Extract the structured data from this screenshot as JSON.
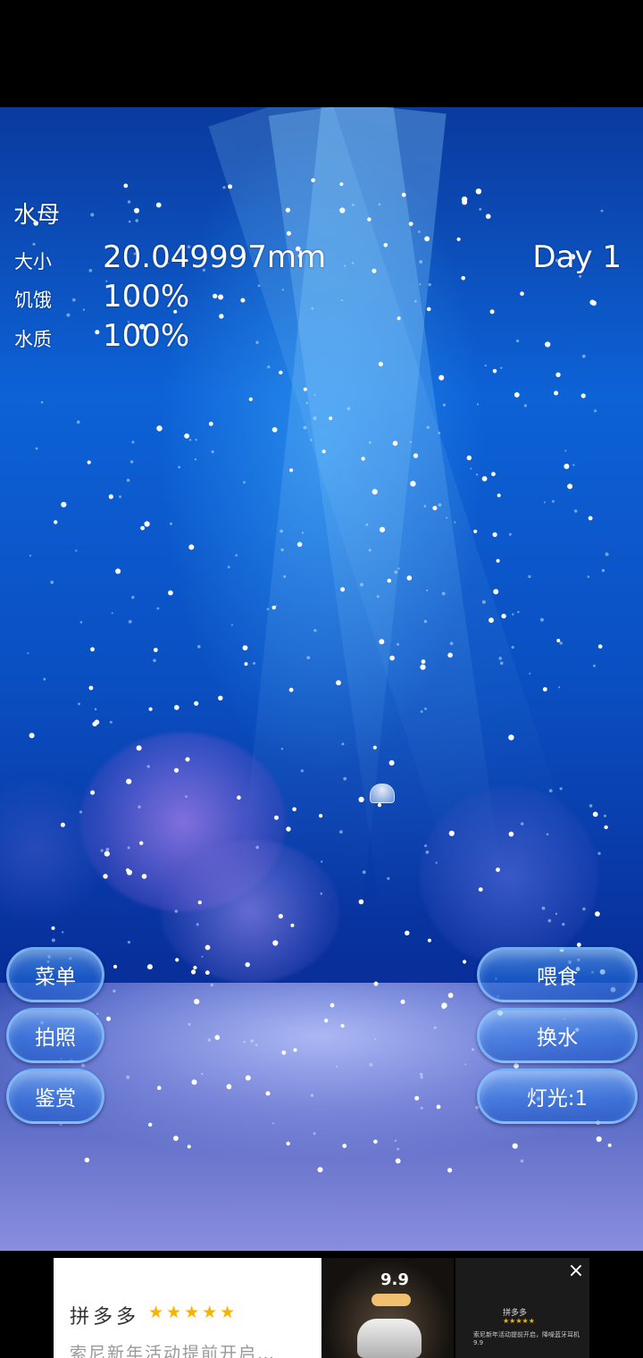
{
  "hud": {
    "title": "水母",
    "size_label": "大小",
    "size_value": "20.049997mm",
    "hunger_label": "饥饿",
    "hunger_value": "100%",
    "water_label": "水质",
    "water_value": "100%",
    "day": "Day 1"
  },
  "buttons": {
    "menu": "菜单",
    "photo": "拍照",
    "appreciate": "鉴赏",
    "feed": "喂食",
    "change_water": "换水",
    "light": "灯光:1"
  },
  "ad": {
    "title": "拼多多",
    "stars": "★★★★★",
    "description": "索尼新年活动提前开启…",
    "price": "9.9",
    "side_name": "拼多多",
    "side_stars": "★★★★★",
    "side_text": "索尼新年活动提前开启，降噪蓝牙耳机9.9",
    "close_icon": "×"
  },
  "colors": {
    "water_top": "#0a3a9e",
    "water_mid": "#0d62d6",
    "button_border": "#8cc8ff",
    "star": "#f6b400"
  }
}
